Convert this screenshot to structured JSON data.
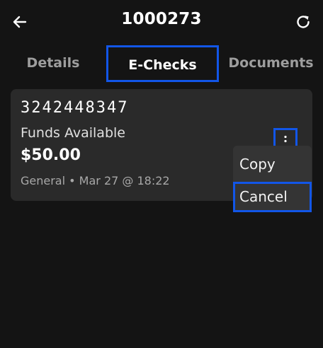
{
  "header": {
    "title": "1000273",
    "back_icon": "arrow-left-icon",
    "refresh_icon": "refresh-icon"
  },
  "tabs": [
    {
      "label": "Details",
      "active": false
    },
    {
      "label": "E-Checks",
      "active": true
    },
    {
      "label": "Documents",
      "active": false
    }
  ],
  "card": {
    "check_number": "3242448347",
    "status": "Funds Available",
    "amount": "$50.00",
    "meta": "General • Mar 27 @ 18:22",
    "more_icon": "more-vertical-icon"
  },
  "menu": {
    "items": [
      {
        "label": "Copy"
      },
      {
        "label": "Cancel"
      }
    ]
  },
  "colors": {
    "background": "#141414",
    "card": "#2a2a2a",
    "menu": "#343434",
    "highlight": "#1256e8"
  }
}
